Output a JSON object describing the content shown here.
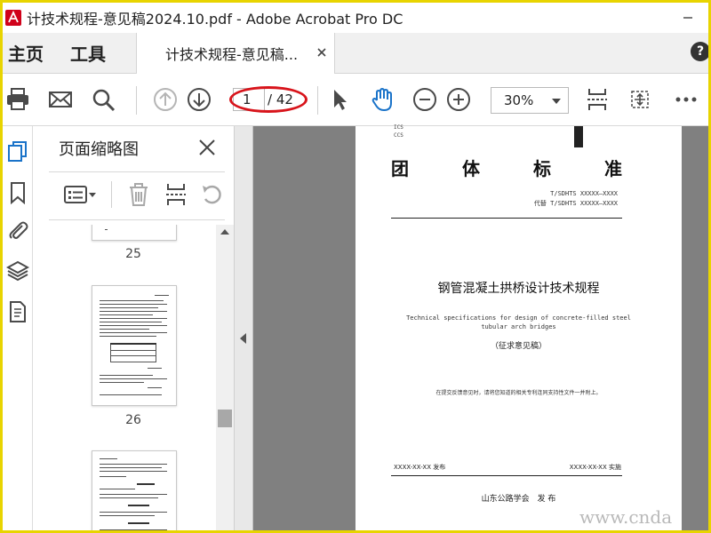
{
  "window": {
    "title": "计技术规程-意见稿2024.10.pdf - Adobe Acrobat Pro DC"
  },
  "tabs": {
    "home": "主页",
    "tools": "工具",
    "document": "计技术规程-意见稿...",
    "help": "?"
  },
  "toolbar": {
    "current_page": "1",
    "total_pages": "/ 42",
    "zoom": "30%"
  },
  "thumbnails_panel": {
    "title": "页面缩略图",
    "pages": [
      {
        "label": "25"
      },
      {
        "label": "26"
      }
    ]
  },
  "pdf_page": {
    "ics_line1": "ICS",
    "ics_line2": "CCS",
    "title_chars": [
      "团",
      "体",
      "标",
      "准"
    ],
    "code_line1": "T/SDHTS  XXXXX—XXXX",
    "code_line2": "代替 T/SDHTS  XXXXX—XXXX",
    "main_title": "钢管混凝土拱桥设计技术规程",
    "en_title_line1": "Technical specifications for design of concrete-filled steel",
    "en_title_line2": "tubular arch bridges",
    "draft_label": "（征求意见稿）",
    "notice": "在提交反馈意见时，请将您知道的相关专利连同支持性文件一并附上。",
    "publish_date": "XXXX-XX-XX 发布",
    "implement_date": "XXXX-XX-XX 实施",
    "issuer": "山东公路学会　发 布"
  },
  "watermark": "www.cnda"
}
